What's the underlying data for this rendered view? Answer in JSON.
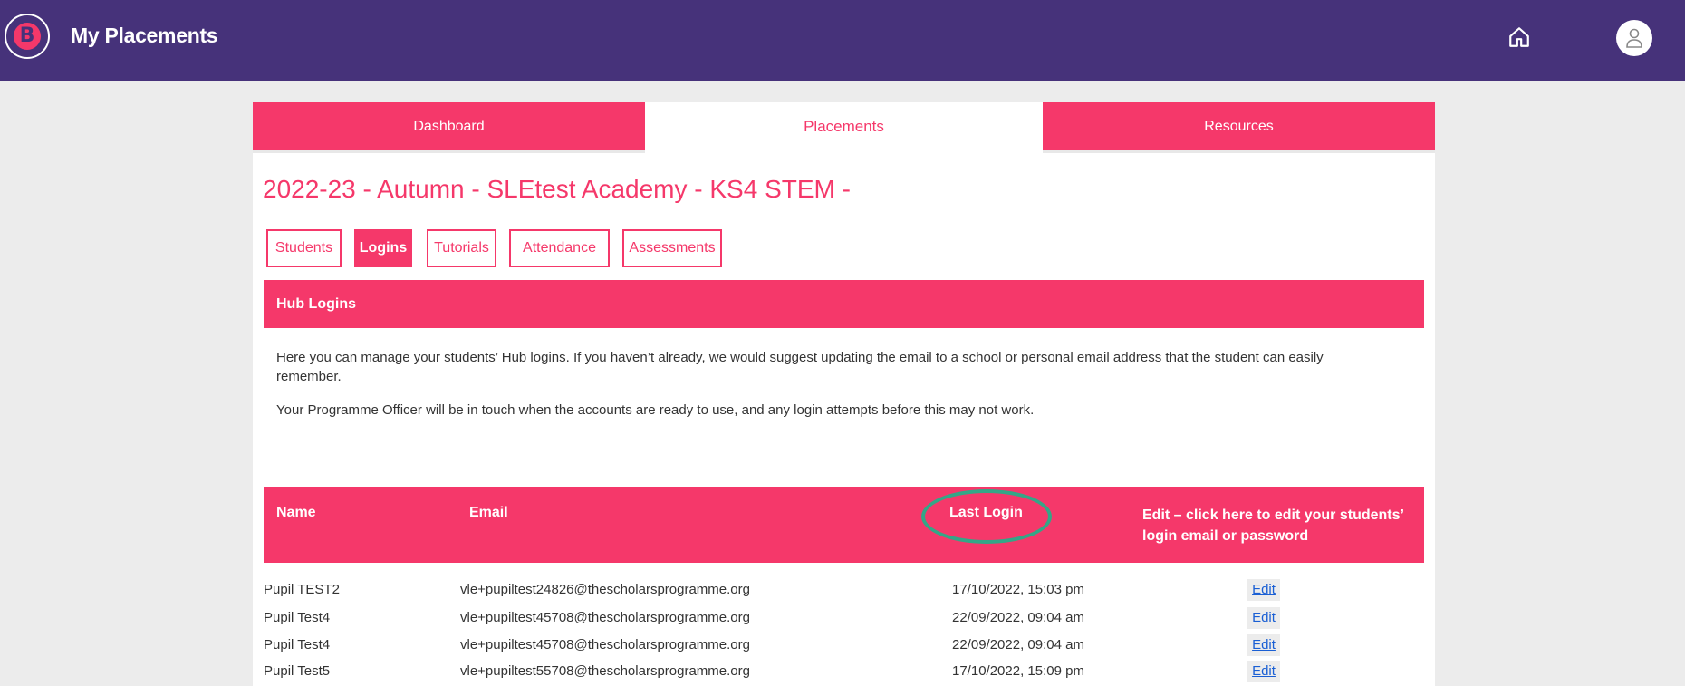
{
  "header": {
    "logo_letter": "B",
    "app_title": "My Placements",
    "home_icon": "home-icon",
    "profile_icon": "user-icon"
  },
  "main_tabs": [
    {
      "label": "Dashboard",
      "active": false
    },
    {
      "label": "Placements",
      "active": true
    },
    {
      "label": "Resources",
      "active": false
    }
  ],
  "course_title": "2022-23 - Autumn - SLEtest Academy - KS4 STEM -",
  "sub_tabs": [
    {
      "label": "Students",
      "active": false
    },
    {
      "label": "Logins",
      "active": true
    },
    {
      "label": "Tutorials",
      "active": false
    },
    {
      "label": "Attendance",
      "active": false
    },
    {
      "label": "Assessments",
      "active": false
    }
  ],
  "section": {
    "title": "Hub Logins",
    "intro_1": "Here you can manage your students’ Hub logins. If you haven’t already, we would suggest updating the email to a school or personal email address that the student can easily remember.",
    "intro_2": "Your Programme Officer will be in touch when the accounts are ready to use, and any login attempts before this may not work."
  },
  "table": {
    "columns": [
      "Name",
      "Email",
      "Last Login",
      "Edit – click here to edit your students’ login email or password"
    ],
    "rows": [
      {
        "name": "Pupil TEST2",
        "email": "vle+pupiltest24826@thescholarsprogramme.org",
        "last_login": "17/10/2022, 15:03 pm",
        "edit": "Edit"
      },
      {
        "name": "Pupil Test4",
        "email": "vle+pupiltest45708@thescholarsprogramme.org",
        "last_login": "22/09/2022, 09:04 am",
        "edit": "Edit"
      },
      {
        "name": "Pupil Test4",
        "email": "vle+pupiltest45708@thescholarsprogramme.org",
        "last_login": "22/09/2022, 09:04 am",
        "edit": "Edit"
      },
      {
        "name": "Pupil Test5",
        "email": "vle+pupiltest55708@thescholarsprogramme.org",
        "last_login": "17/10/2022, 15:09 pm",
        "edit": "Edit"
      }
    ]
  },
  "colors": {
    "header_bg": "#46327a",
    "accent": "#f5386a",
    "highlight_circle": "#34a687",
    "link": "#1a5fd4"
  }
}
